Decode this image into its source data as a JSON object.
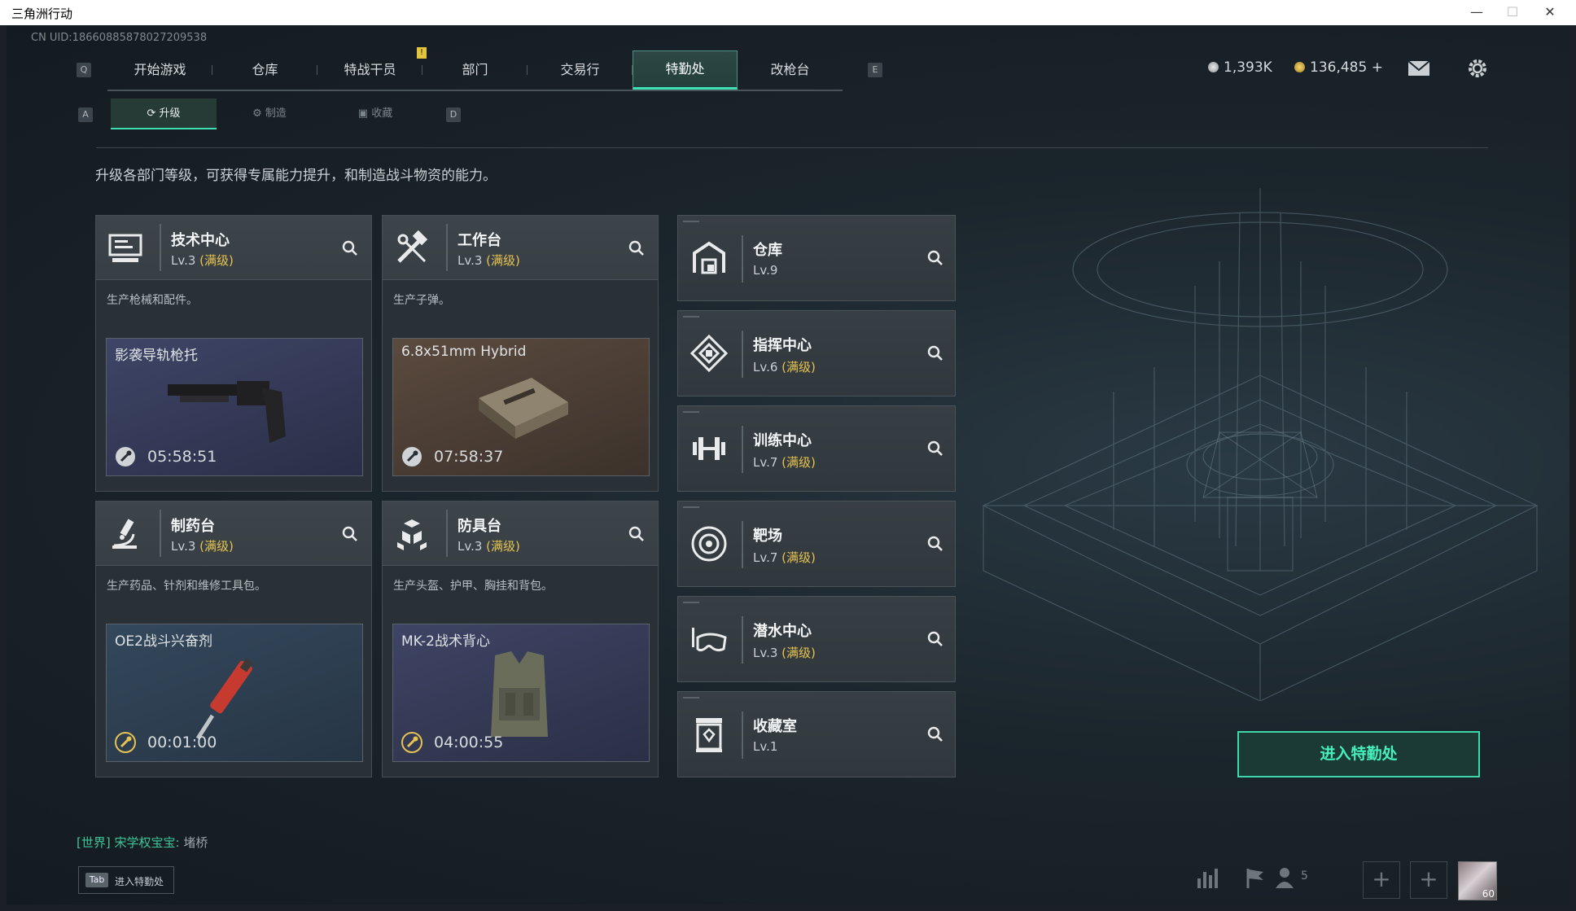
{
  "window": {
    "title": "三角洲行动"
  },
  "uid": "CN UID:18660885878027209538",
  "keys": {
    "left_tab": "Q",
    "right_tab": "E",
    "left_sub": "A",
    "right_sub": "D"
  },
  "nav": {
    "tabs": [
      "开始游戏",
      "仓库",
      "特战干员",
      "部门",
      "交易行",
      "特勤处",
      "改枪台"
    ],
    "notice": "!"
  },
  "currency": {
    "silver": "1,393K",
    "gold": "136,485 +"
  },
  "subnav": {
    "tabs": [
      "升级",
      "制造",
      "收藏"
    ]
  },
  "description": "升级各部门等级，可获得专属能力提升，和制造战斗物资的能力。",
  "workshops": [
    {
      "name": "技术中心",
      "level": "Lv.3",
      "maxed": "(满级)",
      "desc": "生产枪械和配件。",
      "item": "影袭导轨枪托",
      "timer": "05:58:51"
    },
    {
      "name": "工作台",
      "level": "Lv.3",
      "maxed": "(满级)",
      "desc": "生产子弹。",
      "item": "6.8x51mm Hybrid",
      "timer": "07:58:37"
    },
    {
      "name": "制药台",
      "level": "Lv.3",
      "maxed": "(满级)",
      "desc": "生产药品、针剂和维修工具包。",
      "item": "OE2战斗兴奋剂",
      "timer": "00:01:00"
    },
    {
      "name": "防具台",
      "level": "Lv.3",
      "maxed": "(满级)",
      "desc": "生产头盔、护甲、胸挂和背包。",
      "item": "MK-2战术背心",
      "timer": "04:00:55"
    }
  ],
  "facilities": [
    {
      "name": "仓库",
      "level": "Lv.9",
      "maxed": ""
    },
    {
      "name": "指挥中心",
      "level": "Lv.6",
      "maxed": "(满级)"
    },
    {
      "name": "训练中心",
      "level": "Lv.7",
      "maxed": "(满级)"
    },
    {
      "name": "靶场",
      "level": "Lv.7",
      "maxed": "(满级)"
    },
    {
      "name": "潜水中心",
      "level": "Lv.3",
      "maxed": "(满级)"
    },
    {
      "name": "收藏室",
      "level": "Lv.1",
      "maxed": ""
    }
  ],
  "enter_button": "进入特勤处",
  "chat": {
    "channel": "[世界]",
    "sender": "宋学权宝宝:",
    "message": "堵桥"
  },
  "tab_hint": {
    "key": "Tab",
    "label": "进入特勤处"
  },
  "bottom": {
    "friends_count": "5",
    "player_level": "60"
  },
  "colors": {
    "accent": "#3ee0b4",
    "maxed": "#e6c351",
    "panel": "#2a3136"
  }
}
